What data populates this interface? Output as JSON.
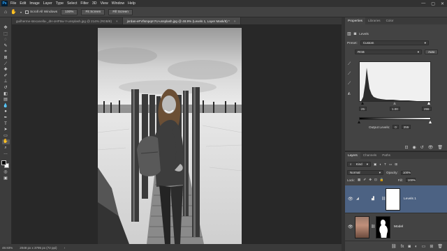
{
  "app": {
    "logo": "Ps"
  },
  "menu": [
    "File",
    "Edit",
    "Image",
    "Layer",
    "Type",
    "Select",
    "Filter",
    "3D",
    "View",
    "Window",
    "Help"
  ],
  "window_controls": [
    "—",
    "▢",
    "✕"
  ],
  "options_bar": {
    "tool_icon": "hand-icon",
    "scroll_all_label": "Scroll All Windows",
    "zoom_button": "100%",
    "fit_screen_button": "Fit Screen",
    "fill_screen_button": "Fill Screen"
  },
  "tabs": [
    {
      "label": "guilherme-stecanella-_dH-oHF9w-Y-unsplash.jpg @ 214% (RGB/8)",
      "active": false,
      "close": "×"
    },
    {
      "label": "jordan-eFVfsmpqm?U-unsplash.jpg @ 48.9% (Levels 1, Layer Mask/8) *",
      "active": true,
      "close": "×"
    }
  ],
  "status_bar": {
    "zoom": "48.93%",
    "doc_info": "2048 px x 3795 px (72 ppi)",
    "arrow": "›"
  },
  "properties": {
    "tabs": [
      "Properties",
      "Libraries",
      "Color"
    ],
    "adjustment_name": "Levels",
    "preset_label": "Preset:",
    "preset_value": "Custom",
    "channel_value": "RGB",
    "auto_button": "Auto",
    "input_black": "25",
    "input_gamma": "1.00",
    "input_white": "255",
    "output_label": "Output Levels:",
    "output_black": "0",
    "output_white": "255"
  },
  "layers": {
    "tabs": [
      "Layers",
      "Channels",
      "Paths"
    ],
    "filter_value": "Kind",
    "blend_mode": "Normal",
    "opacity_label": "Opacity:",
    "opacity_value": "100%",
    "lock_label": "Lock:",
    "fill_label": "Fill:",
    "fill_value": "100%",
    "items": [
      {
        "name": "Levels 1",
        "active": true
      },
      {
        "name": "Model",
        "active": false
      }
    ]
  },
  "colors": {
    "accent": "#4c6283",
    "panel": "#434343",
    "canvas_bg": "#282828"
  }
}
